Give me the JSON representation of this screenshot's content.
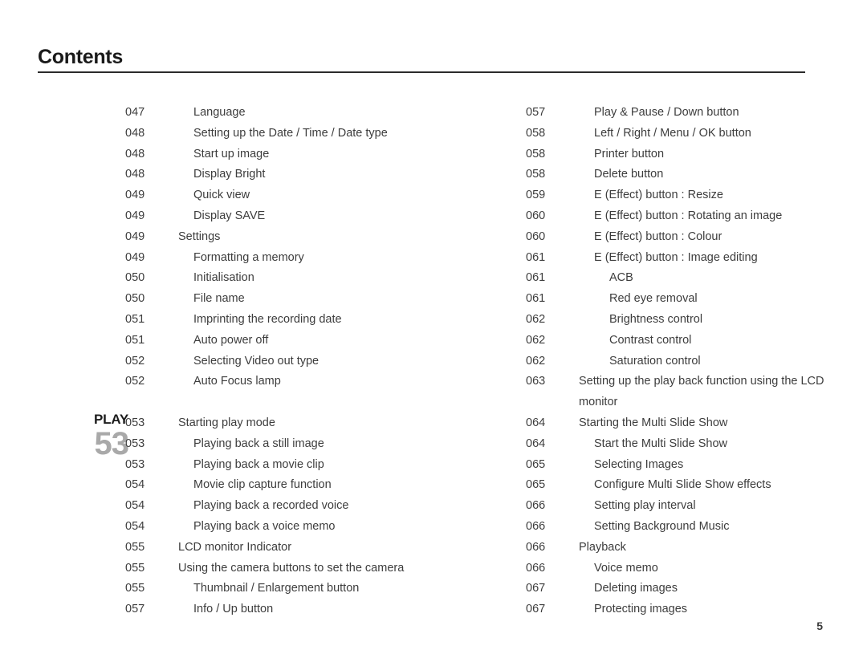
{
  "header": {
    "title": "Contents"
  },
  "footer": {
    "page_number": "5"
  },
  "section_badge": {
    "name": "PLAY",
    "number": "53"
  },
  "colors": {
    "text": "#3d3d3d",
    "title": "#1a1a1a",
    "rule": "#2b2b2b",
    "badge_number": "#a9a9a9",
    "background": "#ffffff"
  },
  "left_column": [
    {
      "page": "047",
      "label": "Language",
      "level": 2
    },
    {
      "page": "048",
      "label": "Setting up the Date / Time / Date type",
      "level": 2
    },
    {
      "page": "048",
      "label": "Start up image",
      "level": 2
    },
    {
      "page": "048",
      "label": "Display Bright",
      "level": 2
    },
    {
      "page": "049",
      "label": "Quick view",
      "level": 2
    },
    {
      "page": "049",
      "label": "Display SAVE",
      "level": 2
    },
    {
      "page": "049",
      "label": "Settings",
      "level": 1
    },
    {
      "page": "049",
      "label": "Formatting a memory",
      "level": 2
    },
    {
      "page": "050",
      "label": "Initialisation",
      "level": 2
    },
    {
      "page": "050",
      "label": "File name",
      "level": 2
    },
    {
      "page": "051",
      "label": "Imprinting the recording date",
      "level": 2
    },
    {
      "page": "051",
      "label": "Auto power off",
      "level": 2
    },
    {
      "page": "052",
      "label": "Selecting Video out type",
      "level": 2
    },
    {
      "page": "052",
      "label": "Auto Focus lamp",
      "level": 2
    },
    {
      "page": "",
      "label": "",
      "level": 1,
      "spacer": true
    },
    {
      "page": "053",
      "label": "Starting play mode",
      "level": 1
    },
    {
      "page": "053",
      "label": "Playing back a still image",
      "level": 2
    },
    {
      "page": "053",
      "label": "Playing back a movie clip",
      "level": 2
    },
    {
      "page": "054",
      "label": "Movie clip capture function",
      "level": 2
    },
    {
      "page": "054",
      "label": "Playing back a recorded voice",
      "level": 2
    },
    {
      "page": "054",
      "label": "Playing back a voice memo",
      "level": 2
    },
    {
      "page": "055",
      "label": "LCD monitor Indicator",
      "level": 1
    },
    {
      "page": "055",
      "label": "Using the camera buttons to set the camera",
      "level": 1
    },
    {
      "page": "055",
      "label": "Thumbnail / Enlargement button",
      "level": 2
    },
    {
      "page": "057",
      "label": "Info / Up button",
      "level": 2
    }
  ],
  "right_column": [
    {
      "page": "057",
      "label": "Play & Pause / Down button",
      "level": 2
    },
    {
      "page": "058",
      "label": "Left / Right / Menu / OK button",
      "level": 2
    },
    {
      "page": "058",
      "label": "Printer button",
      "level": 2
    },
    {
      "page": "058",
      "label": "Delete button",
      "level": 2
    },
    {
      "page": "059",
      "label": "E (Effect) button : Resize",
      "level": 2
    },
    {
      "page": "060",
      "label": "E (Effect) button : Rotating an image",
      "level": 2
    },
    {
      "page": "060",
      "label": "E (Effect) button : Colour",
      "level": 2
    },
    {
      "page": "061",
      "label": "E (Effect) button : Image editing",
      "level": 2
    },
    {
      "page": "061",
      "label": "ACB",
      "level": 3
    },
    {
      "page": "061",
      "label": "Red eye removal",
      "level": 3
    },
    {
      "page": "062",
      "label": "Brightness control",
      "level": 3
    },
    {
      "page": "062",
      "label": "Contrast control",
      "level": 3
    },
    {
      "page": "062",
      "label": "Saturation control",
      "level": 3
    },
    {
      "page": "063",
      "label": "Setting up the play back function using the LCD monitor",
      "level": 1,
      "wrap": true
    },
    {
      "page": "064",
      "label": "Starting the Multi Slide Show",
      "level": 1
    },
    {
      "page": "064",
      "label": "Start the Multi Slide Show",
      "level": 2
    },
    {
      "page": "065",
      "label": "Selecting Images",
      "level": 2
    },
    {
      "page": "065",
      "label": "Configure Multi Slide Show effects",
      "level": 2
    },
    {
      "page": "066",
      "label": "Setting play interval",
      "level": 2
    },
    {
      "page": "066",
      "label": "Setting Background Music",
      "level": 2
    },
    {
      "page": "066",
      "label": "Playback",
      "level": 1
    },
    {
      "page": "066",
      "label": "Voice memo",
      "level": 2
    },
    {
      "page": "067",
      "label": "Deleting images",
      "level": 2
    },
    {
      "page": "067",
      "label": "Protecting images",
      "level": 2
    }
  ]
}
